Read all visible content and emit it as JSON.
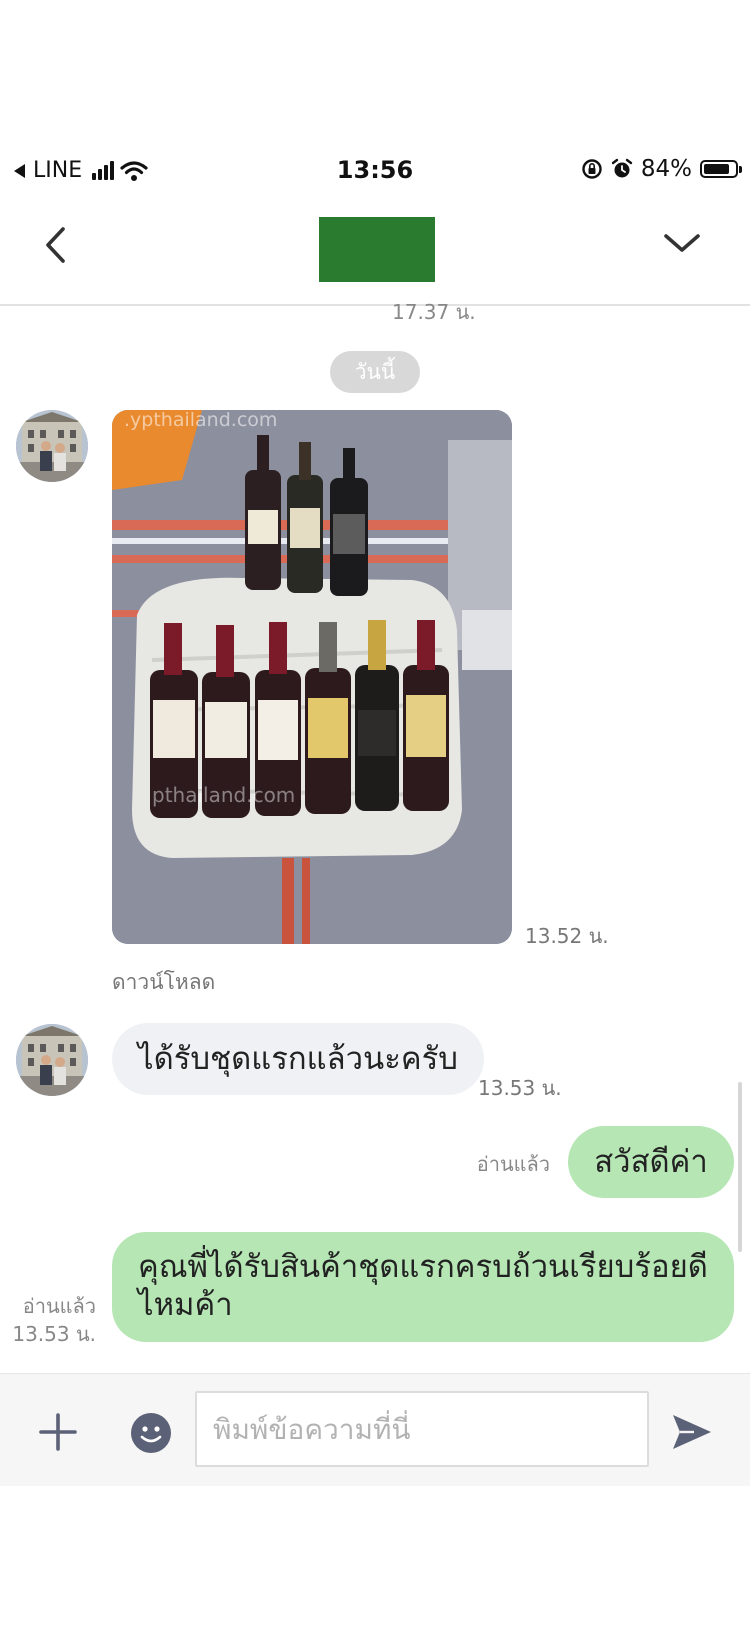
{
  "status_bar": {
    "back_app": "LINE",
    "time": "13:56",
    "battery_percent": "84%",
    "battery_level": 0.84,
    "icons": [
      "signal-icon",
      "wifi-icon",
      "orientation-lock-icon",
      "alarm-icon",
      "battery-icon"
    ]
  },
  "nav": {
    "back_icon": "chevron-left-icon",
    "menu_icon": "chevron-down-icon",
    "title_color": "#2a7a2f"
  },
  "chat": {
    "clipped_time": "17.37 น.",
    "date_chip": "วันนี้",
    "messages": [
      {
        "type": "image",
        "sender": "other",
        "watermark_top": ".ypthailand.com",
        "watermark_bottom": "pthailand.com",
        "time": "13.52 น.",
        "download_label": "ดาวน์โหลด"
      },
      {
        "type": "text",
        "sender": "other",
        "text": "ได้รับชุดแรกแล้วนะครับ",
        "time": "13.53 น."
      },
      {
        "type": "text",
        "sender": "me",
        "text": "สวัสดีค่า",
        "read": "อ่านแล้ว"
      },
      {
        "type": "text",
        "sender": "me",
        "text": "คุณพี่ได้รับสินค้าชุดแรกครบถ้วนเรียบร้อยดีไหมค้า",
        "read": "อ่านแล้ว",
        "time": "13.53 น."
      }
    ]
  },
  "input_bar": {
    "placeholder": "พิมพ์ข้อความที่นี่",
    "value": "",
    "icons": [
      "plus-icon",
      "emoji-icon",
      "send-icon"
    ]
  },
  "colors": {
    "outgoing_bubble": "#b5e6b4",
    "incoming_bubble": "#f0f1f4",
    "icon_gray": "#5b6176"
  }
}
